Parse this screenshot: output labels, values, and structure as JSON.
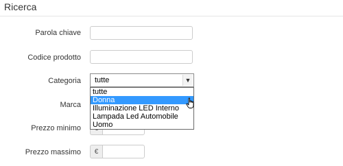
{
  "page": {
    "title": "Ricerca"
  },
  "form": {
    "keyword_label": "Parola chiave",
    "product_code_label": "Codice prodotto",
    "category_label": "Categoria",
    "category_selected": "tutte",
    "category_options": [
      "tutte",
      "Donna",
      "Illuminazione LED Interno",
      "Lampada Led Automobile",
      "Uomo"
    ],
    "category_highlighted": "Donna",
    "brand_label": "Marca",
    "min_price_label": "Prezzo minimo",
    "max_price_label": "Prezzo massimo",
    "currency_symbol": "€"
  },
  "icons": {
    "dropdown_arrow": "chevron-down-icon",
    "cursor": "hand-pointer-icon"
  },
  "colors": {
    "highlight": "#3399ff",
    "border": "#cccccc",
    "addon_bg": "#eeeeee"
  }
}
